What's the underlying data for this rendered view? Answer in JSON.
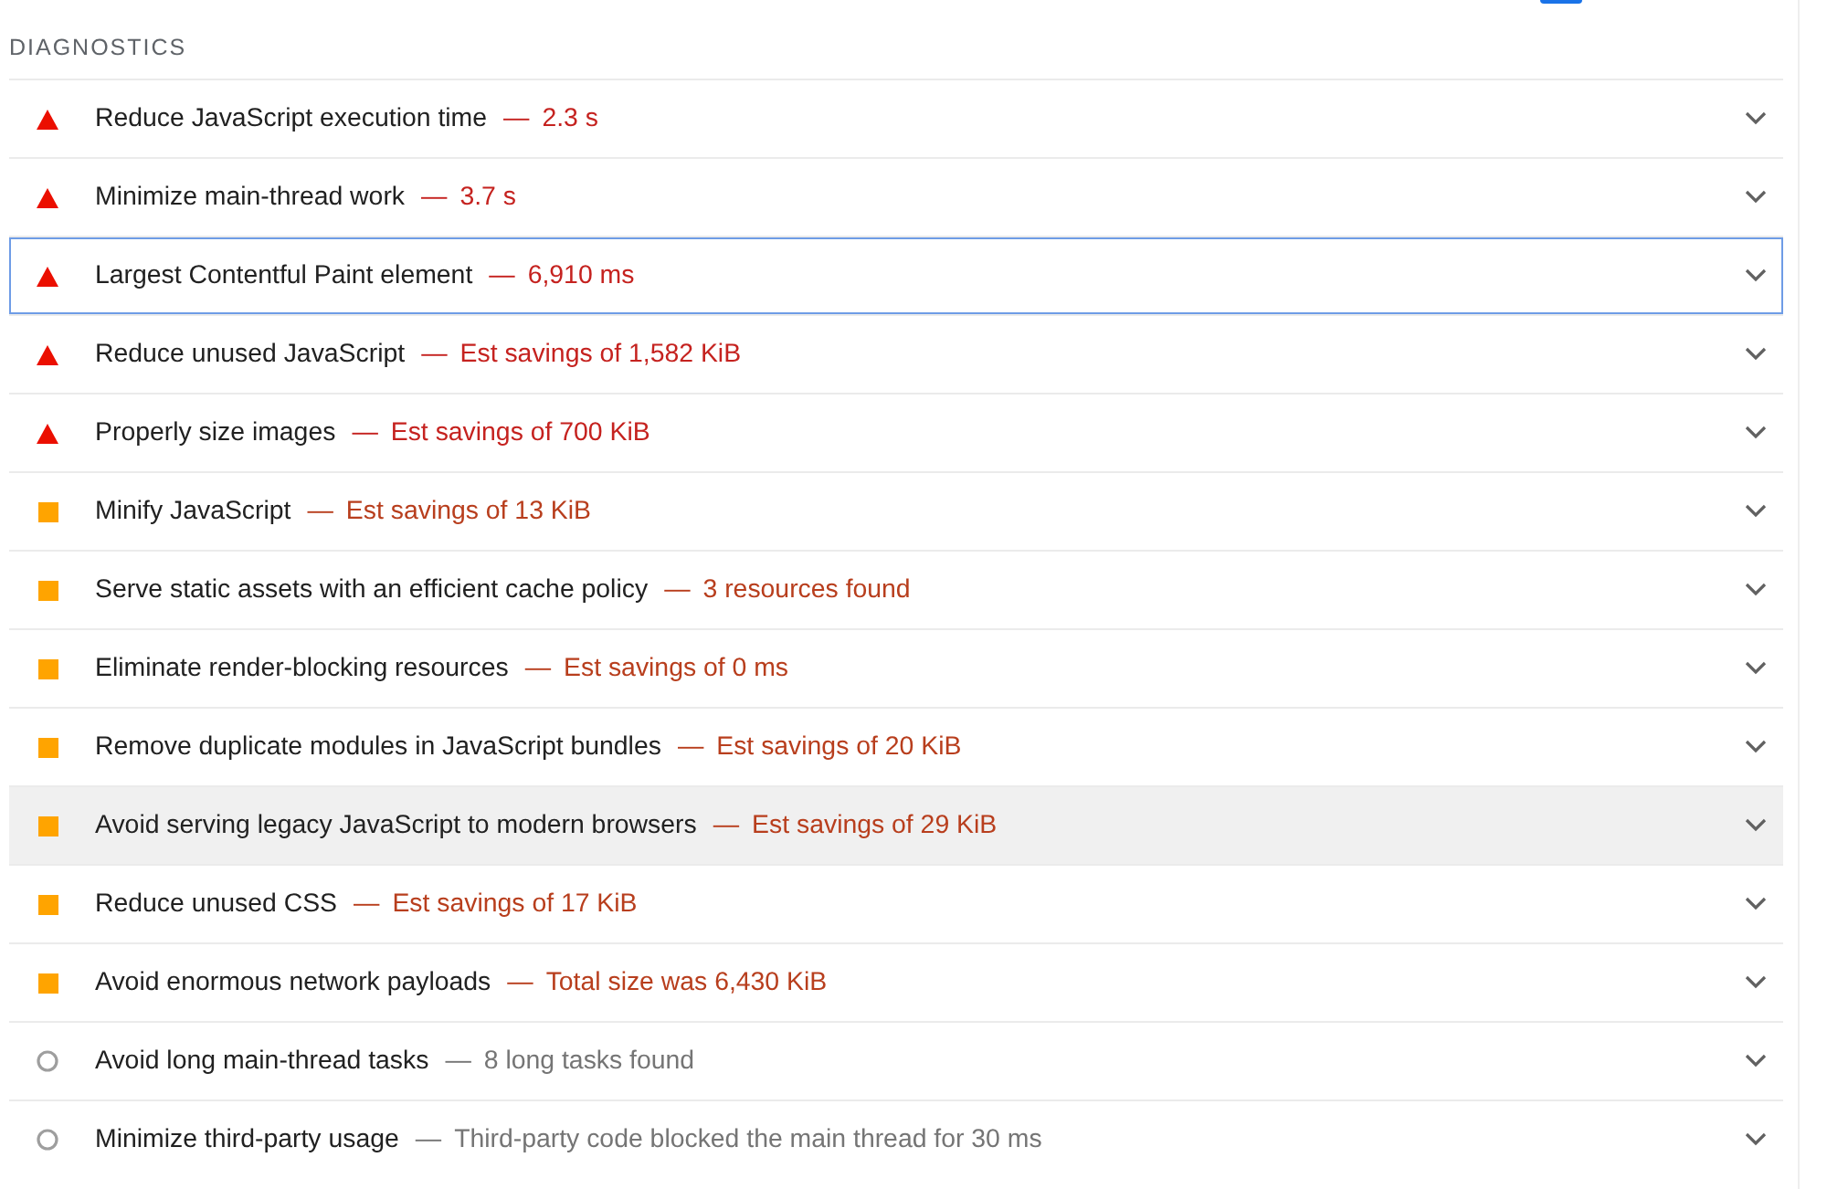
{
  "section": {
    "title": "DIAGNOSTICS"
  },
  "audits": [
    {
      "kind": "fail",
      "title": "Reduce JavaScript execution time",
      "separator": "—",
      "summary": "2.3 s",
      "focused": false,
      "hovered": false,
      "expanded": false
    },
    {
      "kind": "fail",
      "title": "Minimize main-thread work",
      "separator": "—",
      "summary": "3.7 s",
      "focused": false,
      "hovered": false,
      "expanded": false
    },
    {
      "kind": "fail",
      "title": "Largest Contentful Paint element",
      "separator": "—",
      "summary": "6,910 ms",
      "focused": true,
      "hovered": false,
      "expanded": false
    },
    {
      "kind": "fail",
      "title": "Reduce unused JavaScript",
      "separator": "—",
      "summary": "Est savings of 1,582 KiB",
      "focused": false,
      "hovered": false,
      "expanded": false
    },
    {
      "kind": "fail",
      "title": "Properly size images",
      "separator": "—",
      "summary": "Est savings of 700 KiB",
      "focused": false,
      "hovered": false,
      "expanded": false
    },
    {
      "kind": "average",
      "title": "Minify JavaScript",
      "separator": "—",
      "summary": "Est savings of 13 KiB",
      "focused": false,
      "hovered": false,
      "expanded": false
    },
    {
      "kind": "average",
      "title": "Serve static assets with an efficient cache policy",
      "separator": "—",
      "summary": "3 resources found",
      "focused": false,
      "hovered": false,
      "expanded": false
    },
    {
      "kind": "average",
      "title": "Eliminate render-blocking resources",
      "separator": "—",
      "summary": "Est savings of 0 ms",
      "focused": false,
      "hovered": false,
      "expanded": false
    },
    {
      "kind": "average",
      "title": "Remove duplicate modules in JavaScript bundles",
      "separator": "—",
      "summary": "Est savings of 20 KiB",
      "focused": false,
      "hovered": false,
      "expanded": false
    },
    {
      "kind": "average",
      "title": "Avoid serving legacy JavaScript to modern browsers",
      "separator": "—",
      "summary": "Est savings of 29 KiB",
      "focused": false,
      "hovered": true,
      "expanded": false
    },
    {
      "kind": "average",
      "title": "Reduce unused CSS",
      "separator": "—",
      "summary": "Est savings of 17 KiB",
      "focused": false,
      "hovered": false,
      "expanded": false
    },
    {
      "kind": "average",
      "title": "Avoid enormous network payloads",
      "separator": "—",
      "summary": "Total size was 6,430 KiB",
      "focused": false,
      "hovered": false,
      "expanded": false
    },
    {
      "kind": "info",
      "title": "Avoid long main-thread tasks",
      "separator": "—",
      "summary": "8 long tasks found",
      "focused": false,
      "hovered": false,
      "expanded": false
    },
    {
      "kind": "info",
      "title": "Minimize third-party usage",
      "separator": "—",
      "summary": "Third-party code blocked the main thread for 30 ms",
      "focused": false,
      "hovered": false,
      "expanded": false
    }
  ]
}
